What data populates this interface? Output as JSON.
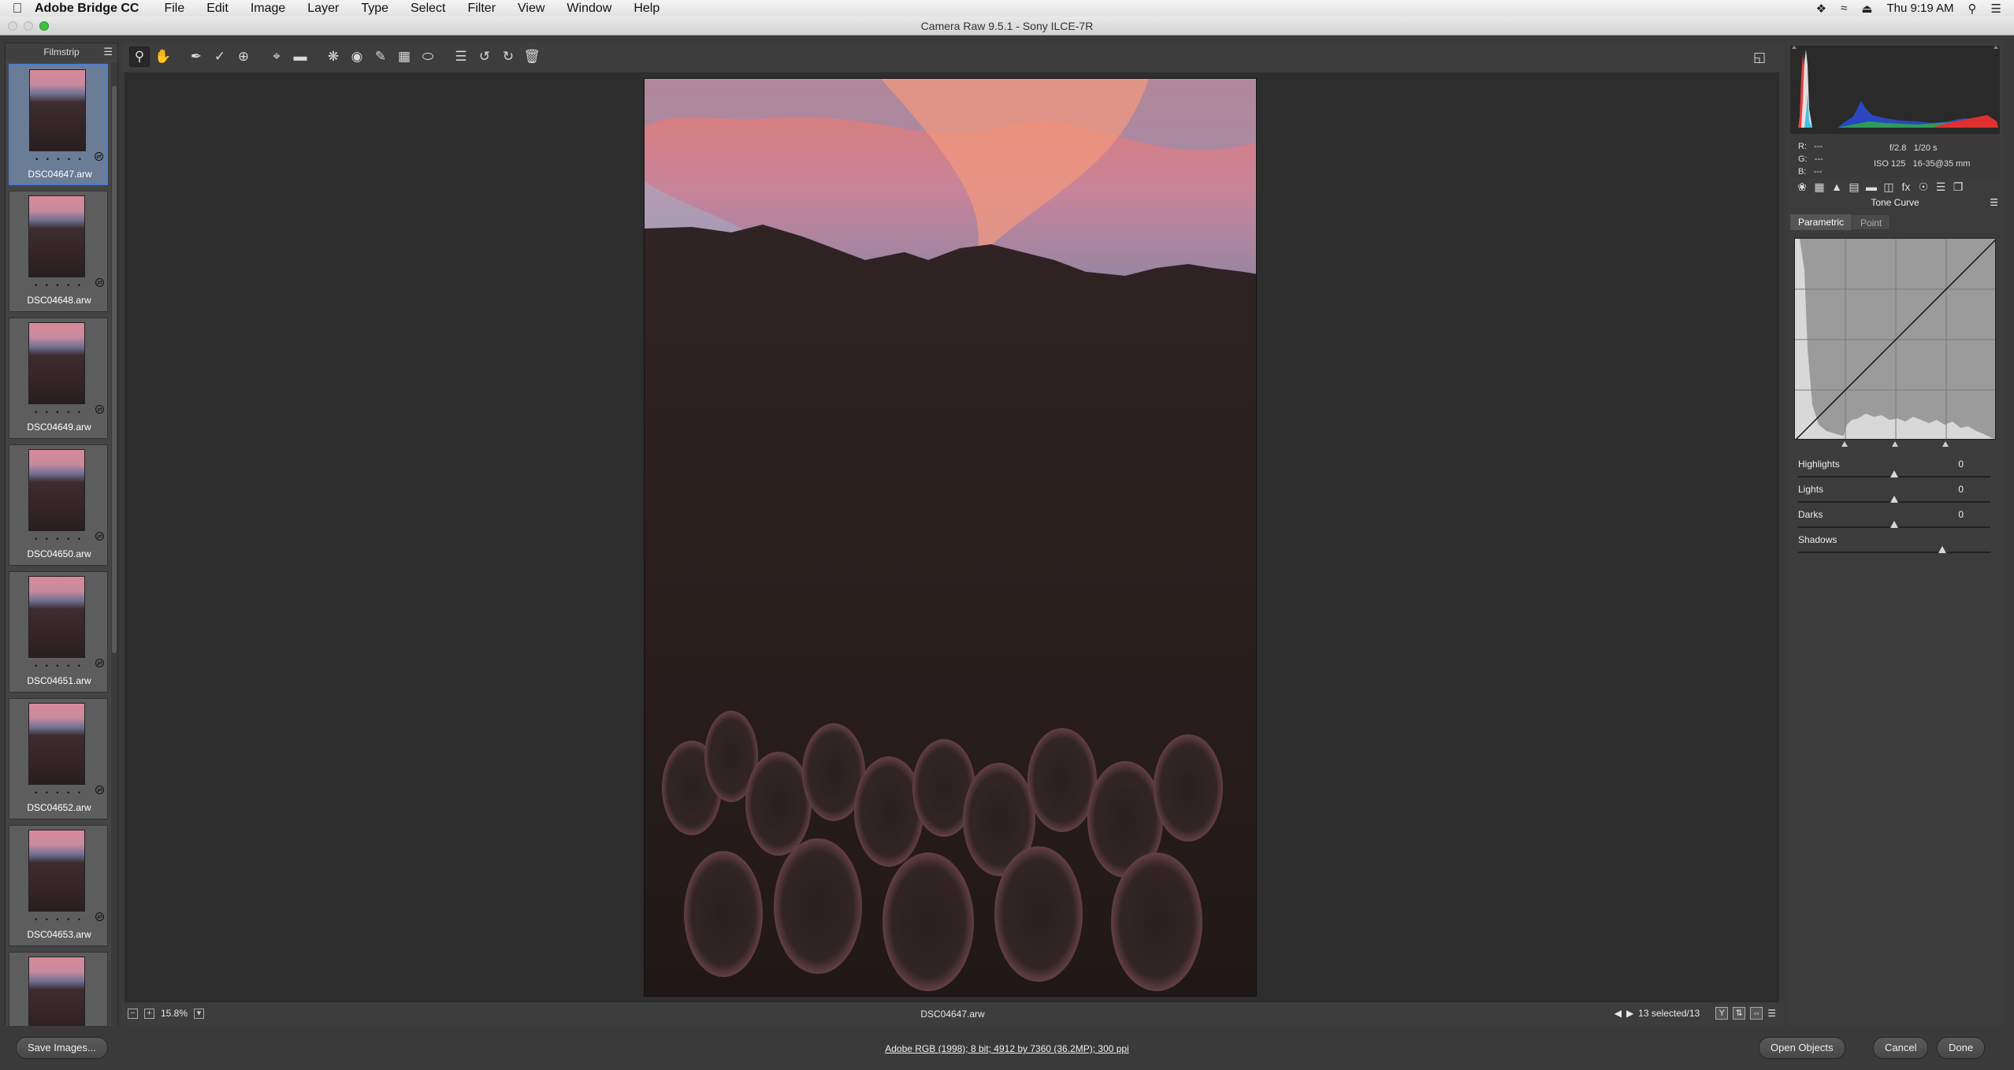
{
  "menubar": {
    "app_name": "Adobe Bridge CC",
    "menus": [
      "File",
      "Edit",
      "Image",
      "Layer",
      "Type",
      "Select",
      "Filter",
      "View",
      "Window",
      "Help"
    ],
    "clock": "Thu 9:19 AM"
  },
  "window": {
    "title": "Camera Raw 9.5.1  -  Sony ILCE-7R"
  },
  "filmstrip": {
    "title": "Filmstrip",
    "items": [
      {
        "filename": "DSC04647.arw",
        "selected": true
      },
      {
        "filename": "DSC04648.arw",
        "selected": false
      },
      {
        "filename": "DSC04649.arw",
        "selected": false
      },
      {
        "filename": "DSC04650.arw",
        "selected": false
      },
      {
        "filename": "DSC04651.arw",
        "selected": false
      },
      {
        "filename": "DSC04652.arw",
        "selected": false
      },
      {
        "filename": "DSC04653.arw",
        "selected": false
      },
      {
        "filename": "",
        "selected": false
      }
    ],
    "rating_dots": "• • • • •"
  },
  "toolbar": {
    "tools": [
      "zoom-tool-icon",
      "hand-tool-icon",
      "white-balance-tool-icon",
      "color-sampler-tool-icon",
      "targeted-adjustment-tool-icon",
      "crop-tool-icon",
      "straighten-tool-icon",
      "spot-removal-tool-icon",
      "red-eye-removal-tool-icon",
      "adjustment-brush-icon",
      "graduated-filter-icon",
      "radial-filter-icon",
      "preferences-icon",
      "rotate-ccw-icon",
      "rotate-cw-icon",
      "trash-icon"
    ]
  },
  "canvas": {
    "zoom_level": "15.8%",
    "current_file": "DSC04647.arw",
    "selection_count": "13 selected/13"
  },
  "info": {
    "r_label": "R:",
    "r_value": "---",
    "g_label": "G:",
    "g_value": "---",
    "b_label": "B:",
    "b_value": "---",
    "aperture": "f/2.8",
    "shutter": "1/20 s",
    "iso": "ISO 125",
    "lens": "16-35@35 mm"
  },
  "panel": {
    "title": "Tone Curve",
    "tab_parametric": "Parametric",
    "tab_point": "Point",
    "sliders": [
      {
        "label": "Highlights",
        "value": "0",
        "pos": 0.5
      },
      {
        "label": "Lights",
        "value": "0",
        "pos": 0.5
      },
      {
        "label": "Darks",
        "value": "0",
        "pos": 0.5
      },
      {
        "label": "Shadows",
        "value": "",
        "pos": 0.75
      }
    ]
  },
  "footer": {
    "save_label": "Save Images...",
    "workflow_text": "Adobe RGB (1998); 8 bit; 4912 by 7360 (36.2MP); 300 ppi",
    "open_label": "Open Objects",
    "cancel_label": "Cancel",
    "done_label": "Done"
  },
  "colors": {
    "accent": "#4f7bd0",
    "panel_bg": "#3c3c3c",
    "canvas_bg": "#2d2d2d"
  }
}
